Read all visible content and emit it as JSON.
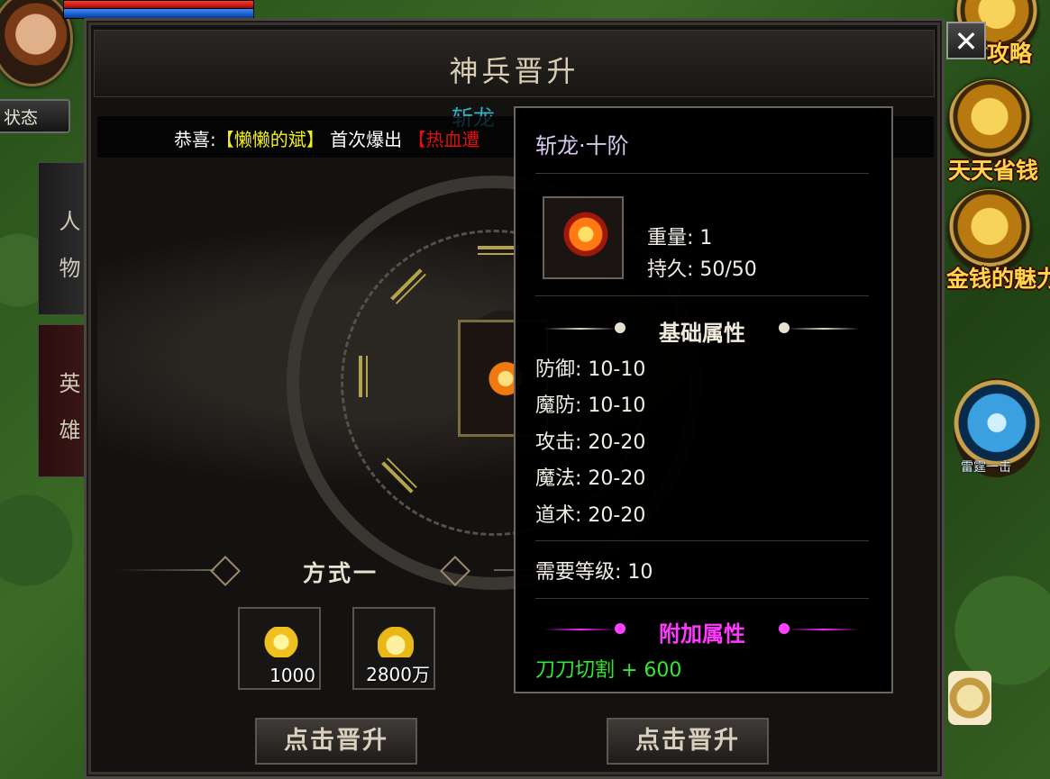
{
  "hud": {
    "status_label": "状态",
    "close_symbol": "✕",
    "right_menu": [
      {
        "label": "攻略",
        "icon": "strategy-icon"
      },
      {
        "label": "天天省钱",
        "icon": "gold-coins-icon"
      },
      {
        "label": "金钱的魅力",
        "icon": "gold-ingot-icon"
      }
    ],
    "skill_label": "雷霆一击"
  },
  "side_tabs": [
    {
      "label": "人物"
    },
    {
      "label": "英雄"
    }
  ],
  "panel": {
    "title": "神兵晋升",
    "notice": {
      "prefix": "恭喜:",
      "player": "【懒懒的斌】",
      "middle": " 首次爆出 ",
      "item": "【热血遭"
    },
    "floating_name": "斩龙",
    "method_label": "方式一",
    "costs": [
      {
        "icon": "gold-shard-icon",
        "quantity": "1000"
      },
      {
        "icon": "gold-ingot-icon",
        "quantity": "2800万"
      }
    ],
    "upgrade_buttons": [
      "点击晋升",
      "点击晋升"
    ]
  },
  "tooltip": {
    "title": "斩龙·十阶",
    "weight": "重量: 1",
    "durability": "持久: 50/50",
    "base_header": "基础属性",
    "stats": [
      "防御: 10-10",
      "魔防: 10-10",
      "攻击: 20-20",
      "魔法: 20-20",
      "道术: 20-20"
    ],
    "required_level": "需要等级: 10",
    "extra_header": "附加属性",
    "extra_stat": "刀刀切割 + 600"
  },
  "colors": {
    "notice_player": "#f2f21a",
    "notice_item": "#e01010",
    "tooltip_title": "#d6c9ef",
    "extra_header": "#ff3aff",
    "extra_stat": "#33e832"
  }
}
